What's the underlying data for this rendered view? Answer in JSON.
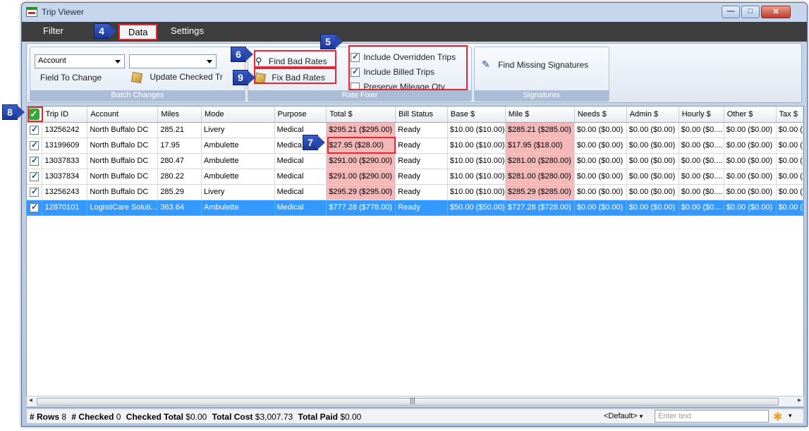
{
  "window": {
    "title": "Trip Viewer"
  },
  "menu": {
    "items": [
      {
        "label": "Filter"
      },
      {
        "label": "Data"
      },
      {
        "label": "Settings"
      }
    ]
  },
  "batch_changes": {
    "field_combo": "Account",
    "value_combo": "",
    "field_to_change_label": "Field To Change",
    "update_checked_label": "Update Checked Tr",
    "group_label": "Batch Changes"
  },
  "rate_fixer": {
    "find_bad_rates": "Find Bad Rates",
    "fix_bad_rates": "Fix Bad Rates",
    "include_overridden": "Include Overridden Trips",
    "include_billed": "Include Billed Trips",
    "preserve_mileage": "Preserve Mileage Qty",
    "group_label": "Rate Fixer"
  },
  "signatures": {
    "find_missing": "Find Missing Signatures",
    "group_label": "Signatures"
  },
  "callouts": [
    "4",
    "5",
    "6",
    "7",
    "8",
    "9"
  ],
  "grid": {
    "columns": [
      "Trip ID",
      "Account",
      "Miles",
      "Mode",
      "Purpose",
      "Total $",
      "Bill Status",
      "Base $",
      "Mile $",
      "Needs $",
      "Admin $",
      "Hourly $",
      "Other $",
      "Tax $"
    ],
    "rows": [
      [
        "13256242",
        "North Buffalo DC",
        "285.21",
        "Livery",
        "Medical",
        "$295.21 ($295.00)",
        "Ready",
        "$10.00 ($10.00)",
        "$285.21 ($285.00)",
        "$0.00 ($0.00)",
        "$0.00 ($0.00)",
        "$0.00 ($0....",
        "$0.00 ($0.00)",
        "$0.00 ("
      ],
      [
        "13199609",
        "North Buffalo DC",
        "17.95",
        "Ambulette",
        "Medica",
        "$27.95 ($28.00)",
        "Ready",
        "$10.00 ($10.00)",
        "$17.95 ($18.00)",
        "$0.00 ($0.00)",
        "$0.00 ($0.00)",
        "$0.00 ($0....",
        "$0.00 ($0.00)",
        "$0.00 ("
      ],
      [
        "13037833",
        "North Buffalo DC",
        "280.47",
        "Ambulette",
        "Medical",
        "$291.00 ($290.00)",
        "Ready",
        "$10.00 ($10.00)",
        "$281.00 ($280.00)",
        "$0.00 ($0.00)",
        "$0.00 ($0.00)",
        "$0.00 ($0....",
        "$0.00 ($0.00)",
        "$0.00 ("
      ],
      [
        "13037834",
        "North Buffalo DC",
        "280.22",
        "Ambulette",
        "Medical",
        "$291.00 ($290.00)",
        "Ready",
        "$10.00 ($10.00)",
        "$281.00 ($280.00)",
        "$0.00 ($0.00)",
        "$0.00 ($0.00)",
        "$0.00 ($0....",
        "$0.00 ($0.00)",
        "$0.00 ("
      ],
      [
        "13256243",
        "North Buffalo DC",
        "285.29",
        "Livery",
        "Medical",
        "$295.29 ($295.00)",
        "Ready",
        "$10.00 ($10.00)",
        "$285.29 ($285.00)",
        "$0.00 ($0.00)",
        "$0.00 ($0.00)",
        "$0.00 ($0....",
        "$0.00 ($0.00)",
        "$0.00 ("
      ],
      [
        "12870101",
        "LogistiCare Soluti...",
        "363.64",
        "Ambulette",
        "Medical",
        "$777.28 ($778.00)",
        "Ready",
        "$50.00 ($50.00)",
        "$727.28 ($728.00)",
        "$0.00 ($0.00)",
        "$0.00 ($0.00)",
        "$0.00 ($0....",
        "$0.00 ($0.00)",
        "$0.00 ("
      ]
    ]
  },
  "status": {
    "rows_label": "# Rows",
    "rows_value": "8",
    "checked_label": "# Checked",
    "checked_value": "0",
    "checked_total_label": "Checked Total",
    "checked_total_value": "$0.00",
    "total_cost_label": "Total Cost",
    "total_cost_value": "$3,007.73",
    "total_paid_label": "Total Paid",
    "total_paid_value": "$0.00",
    "default_combo": "<Default>",
    "filter_placeholder": "Enter text"
  }
}
